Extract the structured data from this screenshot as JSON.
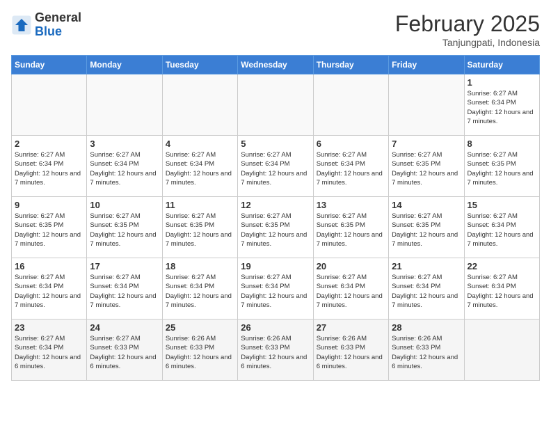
{
  "logo": {
    "general": "General",
    "blue": "Blue"
  },
  "title": "February 2025",
  "subtitle": "Tanjungpati, Indonesia",
  "days_of_week": [
    "Sunday",
    "Monday",
    "Tuesday",
    "Wednesday",
    "Thursday",
    "Friday",
    "Saturday"
  ],
  "weeks": [
    [
      {
        "day": "",
        "info": ""
      },
      {
        "day": "",
        "info": ""
      },
      {
        "day": "",
        "info": ""
      },
      {
        "day": "",
        "info": ""
      },
      {
        "day": "",
        "info": ""
      },
      {
        "day": "",
        "info": ""
      },
      {
        "day": "1",
        "info": "Sunrise: 6:27 AM\nSunset: 6:34 PM\nDaylight: 12 hours and 7 minutes."
      }
    ],
    [
      {
        "day": "2",
        "info": "Sunrise: 6:27 AM\nSunset: 6:34 PM\nDaylight: 12 hours and 7 minutes."
      },
      {
        "day": "3",
        "info": "Sunrise: 6:27 AM\nSunset: 6:34 PM\nDaylight: 12 hours and 7 minutes."
      },
      {
        "day": "4",
        "info": "Sunrise: 6:27 AM\nSunset: 6:34 PM\nDaylight: 12 hours and 7 minutes."
      },
      {
        "day": "5",
        "info": "Sunrise: 6:27 AM\nSunset: 6:34 PM\nDaylight: 12 hours and 7 minutes."
      },
      {
        "day": "6",
        "info": "Sunrise: 6:27 AM\nSunset: 6:34 PM\nDaylight: 12 hours and 7 minutes."
      },
      {
        "day": "7",
        "info": "Sunrise: 6:27 AM\nSunset: 6:35 PM\nDaylight: 12 hours and 7 minutes."
      },
      {
        "day": "8",
        "info": "Sunrise: 6:27 AM\nSunset: 6:35 PM\nDaylight: 12 hours and 7 minutes."
      }
    ],
    [
      {
        "day": "9",
        "info": "Sunrise: 6:27 AM\nSunset: 6:35 PM\nDaylight: 12 hours and 7 minutes."
      },
      {
        "day": "10",
        "info": "Sunrise: 6:27 AM\nSunset: 6:35 PM\nDaylight: 12 hours and 7 minutes."
      },
      {
        "day": "11",
        "info": "Sunrise: 6:27 AM\nSunset: 6:35 PM\nDaylight: 12 hours and 7 minutes."
      },
      {
        "day": "12",
        "info": "Sunrise: 6:27 AM\nSunset: 6:35 PM\nDaylight: 12 hours and 7 minutes."
      },
      {
        "day": "13",
        "info": "Sunrise: 6:27 AM\nSunset: 6:35 PM\nDaylight: 12 hours and 7 minutes."
      },
      {
        "day": "14",
        "info": "Sunrise: 6:27 AM\nSunset: 6:35 PM\nDaylight: 12 hours and 7 minutes."
      },
      {
        "day": "15",
        "info": "Sunrise: 6:27 AM\nSunset: 6:34 PM\nDaylight: 12 hours and 7 minutes."
      }
    ],
    [
      {
        "day": "16",
        "info": "Sunrise: 6:27 AM\nSunset: 6:34 PM\nDaylight: 12 hours and 7 minutes."
      },
      {
        "day": "17",
        "info": "Sunrise: 6:27 AM\nSunset: 6:34 PM\nDaylight: 12 hours and 7 minutes."
      },
      {
        "day": "18",
        "info": "Sunrise: 6:27 AM\nSunset: 6:34 PM\nDaylight: 12 hours and 7 minutes."
      },
      {
        "day": "19",
        "info": "Sunrise: 6:27 AM\nSunset: 6:34 PM\nDaylight: 12 hours and 7 minutes."
      },
      {
        "day": "20",
        "info": "Sunrise: 6:27 AM\nSunset: 6:34 PM\nDaylight: 12 hours and 7 minutes."
      },
      {
        "day": "21",
        "info": "Sunrise: 6:27 AM\nSunset: 6:34 PM\nDaylight: 12 hours and 7 minutes."
      },
      {
        "day": "22",
        "info": "Sunrise: 6:27 AM\nSunset: 6:34 PM\nDaylight: 12 hours and 7 minutes."
      }
    ],
    [
      {
        "day": "23",
        "info": "Sunrise: 6:27 AM\nSunset: 6:34 PM\nDaylight: 12 hours and 6 minutes."
      },
      {
        "day": "24",
        "info": "Sunrise: 6:27 AM\nSunset: 6:33 PM\nDaylight: 12 hours and 6 minutes."
      },
      {
        "day": "25",
        "info": "Sunrise: 6:26 AM\nSunset: 6:33 PM\nDaylight: 12 hours and 6 minutes."
      },
      {
        "day": "26",
        "info": "Sunrise: 6:26 AM\nSunset: 6:33 PM\nDaylight: 12 hours and 6 minutes."
      },
      {
        "day": "27",
        "info": "Sunrise: 6:26 AM\nSunset: 6:33 PM\nDaylight: 12 hours and 6 minutes."
      },
      {
        "day": "28",
        "info": "Sunrise: 6:26 AM\nSunset: 6:33 PM\nDaylight: 12 hours and 6 minutes."
      },
      {
        "day": "",
        "info": ""
      }
    ]
  ]
}
